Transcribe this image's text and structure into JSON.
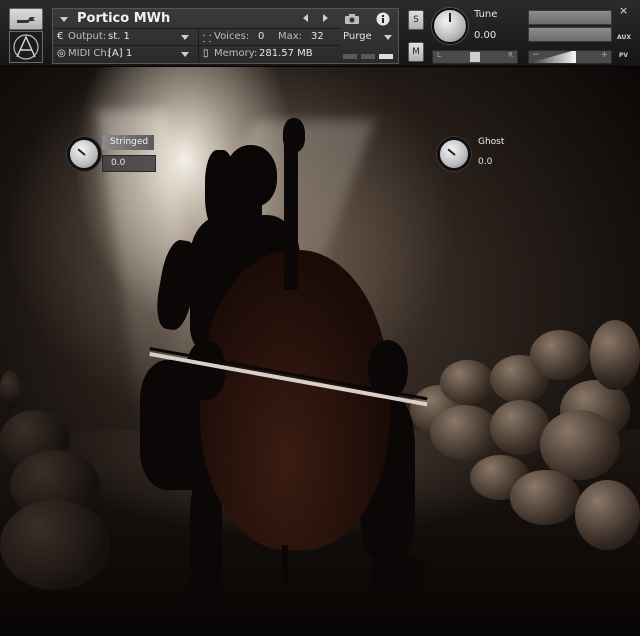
{
  "header": {
    "instrument_name": "Portico MWh",
    "output_label": "Output:",
    "output_value": "st. 1",
    "voices_label": "Voices:",
    "voices_value": "0",
    "max_label": "Max:",
    "max_value": "32",
    "purge_label": "Purge",
    "midi_label": "MIDI Ch:",
    "midi_value": "[A]  1",
    "memory_label": "Memory:",
    "memory_value": "281.57 MB",
    "solo_label": "S",
    "mute_label": "M",
    "tune_label": "Tune",
    "tune_value": "0.00",
    "pan_left_label": "L",
    "pan_right_label": "R",
    "volume_minus": "−",
    "volume_plus": "+",
    "aux_label": "AUX",
    "pv_label": "PV",
    "close_label": "×"
  },
  "controls": {
    "stringed": {
      "label": "Stringed",
      "value": "0.0"
    },
    "ghost": {
      "label": "Ghost",
      "value": "0.0"
    }
  },
  "levels": {
    "pan": 0.5,
    "volume": 0.55
  },
  "icons": {
    "tool": "wrench-icon",
    "logo": "instrument-logo-icon",
    "camera": "camera-icon",
    "info": "info-icon",
    "output": "output-icon",
    "midi": "midi-icon",
    "voices": "voices-icon",
    "memory": "memory-icon"
  }
}
